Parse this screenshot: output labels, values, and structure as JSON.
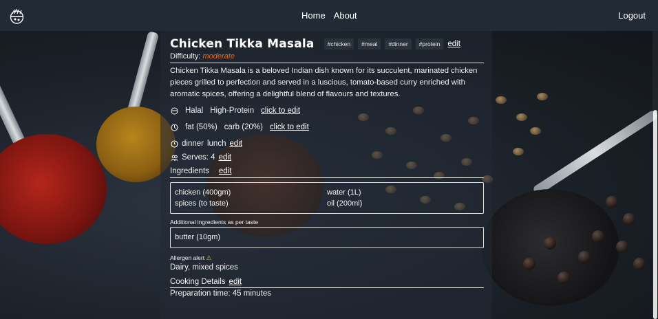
{
  "nav": {
    "home": "Home",
    "about": "About",
    "logout": "Logout"
  },
  "recipe": {
    "title": "Chicken Tikka Masala",
    "tags": [
      "#chicken",
      "#meal",
      "#dinner",
      "#protein"
    ],
    "tags_edit": "edit",
    "difficulty_label": "Difficulty:",
    "difficulty": "moderate",
    "description": "Chicken Tikka Masala is a beloved Indian dish known for its succulent, marinated chicken pieces grilled to perfection and served in a luscious, tomato-based curry enriched with aromatic spices, offering a delightful blend of flavours and textures.",
    "diet": {
      "items": [
        "Halal",
        "High-Protein"
      ],
      "edit": "click to edit"
    },
    "macros": {
      "items": [
        "fat (50%)",
        "carb (20%)"
      ],
      "edit": "click to edit"
    },
    "meal_times": {
      "items": [
        "dinner",
        "lunch"
      ],
      "edit": "edit"
    },
    "serves": {
      "text": "Serves: 4",
      "edit": "edit"
    },
    "ingredients": {
      "label": "Ingredients",
      "edit": "edit",
      "items": [
        "chicken (400gm)",
        "water (1L)",
        "spices (to taste)",
        "oil (200ml)"
      ]
    },
    "additional": {
      "label": "Additional ingredients as per taste",
      "items": [
        "butter (10gm)"
      ]
    },
    "allergen": {
      "label": "Allergen alert",
      "value": "Dairy, mixed spices"
    },
    "cooking": {
      "label": "Cooking Details",
      "edit": "edit",
      "prep": "Preparation time: 45 minutes"
    }
  },
  "colors": {
    "accent_difficulty": "#f06a1f",
    "warning": "#f5c400",
    "topbar": "#222b35"
  }
}
